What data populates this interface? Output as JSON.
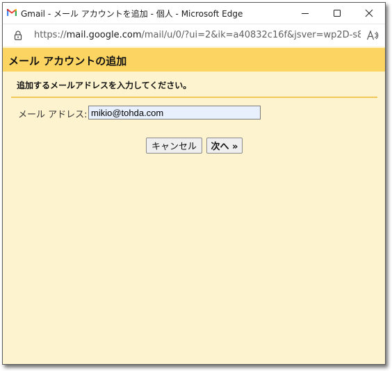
{
  "window": {
    "title": "Gmail - メール アカウントを追加 - 個人 - Microsoft Edge",
    "app_icon": "gmail-icon",
    "controls": {
      "minimize_icon": "minimize-icon",
      "maximize_icon": "maximize-icon",
      "close_icon": "close-icon"
    }
  },
  "address_bar": {
    "scheme": "https://",
    "host": "mail.google.com",
    "path": "/mail/u/0/?ui=2&ik=a40832c16f&jsver=wp2D-s8...",
    "lock_icon": "lock-icon",
    "read_aloud_icon": "read-aloud-icon"
  },
  "dialog": {
    "title": "メール アカウントの追加",
    "instruction": "追加するメールアドレスを入力してください。",
    "email_label": "メール アドレス:",
    "email_value": "mikio@tohda.com",
    "cancel_label": "キャンセル",
    "next_label": "次へ »"
  },
  "colors": {
    "header": "#fcd462",
    "background": "#fdf3cf",
    "divider": "#f2c75a",
    "input_fill": "#e8f0fe"
  }
}
